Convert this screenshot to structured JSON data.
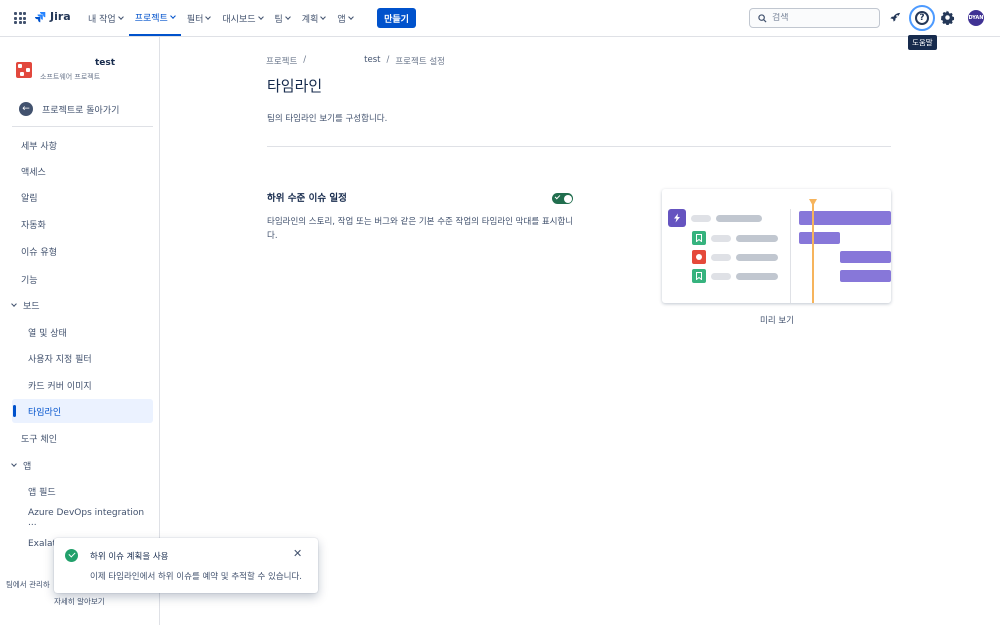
{
  "topnav": {
    "logo": "Jira",
    "items": [
      {
        "label": "내 작업"
      },
      {
        "label": "프로젝트"
      },
      {
        "label": "필터"
      },
      {
        "label": "대시보드"
      },
      {
        "label": "팀"
      },
      {
        "label": "계획"
      },
      {
        "label": "앱"
      }
    ],
    "create_label": "만들기",
    "search_placeholder": "검색",
    "help_tooltip": "도움말",
    "avatar_initials": "DYAN"
  },
  "sidebar": {
    "project_name": "test",
    "project_type": "소프트웨어 프로젝트",
    "back_label": "프로젝트로 돌아가기",
    "items": [
      {
        "label": "세부 사항"
      },
      {
        "label": "액세스"
      },
      {
        "label": "알림"
      },
      {
        "label": "자동화"
      },
      {
        "label": "이슈 유형"
      },
      {
        "label": "기능"
      },
      {
        "label": "보드"
      },
      {
        "label": "열 및 상태"
      },
      {
        "label": "사용자 지정 필터"
      },
      {
        "label": "카드 커버 이미지"
      },
      {
        "label": "타임라인"
      },
      {
        "label": "도구 체인"
      },
      {
        "label": "앱"
      },
      {
        "label": "앱 필드"
      },
      {
        "label": "Azure DevOps integration ..."
      },
      {
        "label": "Exalat"
      }
    ],
    "bottom_text": "팀에서 관리하",
    "learn_more": "자세히 알아보기"
  },
  "main": {
    "breadcrumb": [
      "프로젝트",
      "/",
      "test",
      "/",
      "프로젝트 설정"
    ],
    "title": "타임라인",
    "description": "팀의 타임라인 보기를 구성합니다.",
    "section": {
      "title": "하위 수준 이슈 일정",
      "toggle_on": true,
      "description": "타임라인의 스토리, 작업 또는 버그와 같은 기본 수준 작업의 타임라인 막대를 표시합니다."
    },
    "preview_label": "미리 보기"
  },
  "flag": {
    "title": "하위 이슈 계획을 사용",
    "description": "이제 타임라인에서 하위 이슈를 예약 및 추적할 수 있습니다."
  },
  "colors": {
    "brand": "#0052cc",
    "toggle_on": "#216e4e",
    "epic": "#6554c0",
    "bar": "#8777d9",
    "today": "#f6b45c",
    "success": "#22a06b"
  }
}
